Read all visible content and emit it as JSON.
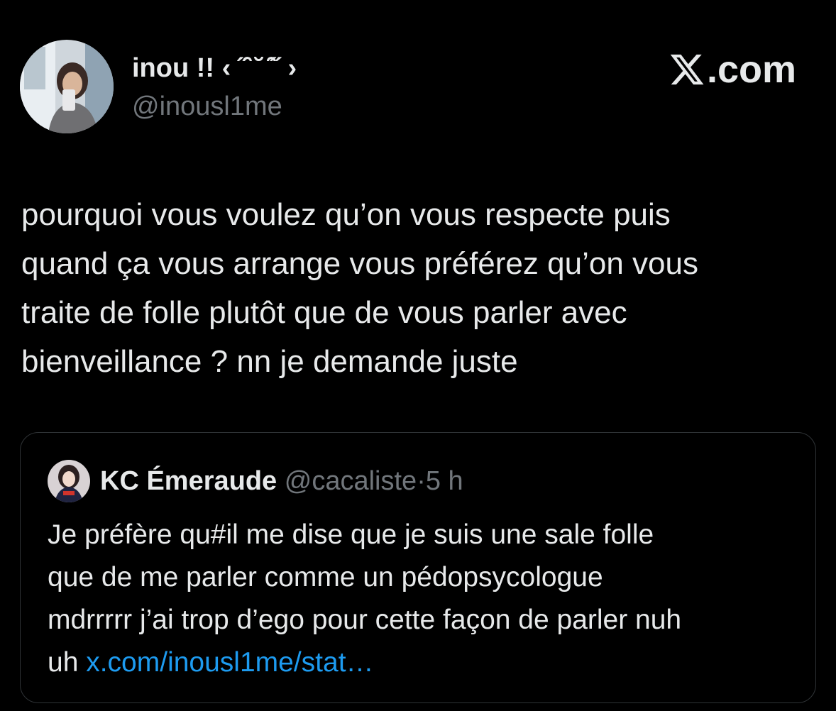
{
  "post": {
    "author_name": "inou !! ‹ ˝̑̑ ˘ ̑̑˝ ›",
    "author_handle": "@inousl1me",
    "brand": ".com",
    "text_lines": [
      "pourquoi vous voulez qu’on vous respecte puis",
      "quand ça vous arrange vous préférez qu’on vous",
      "traite de folle plutôt que de vous parler avec",
      "bienveillance ? nn je demande juste"
    ]
  },
  "quote": {
    "author_name": "KC Émeraude",
    "author_handle": "@cacaliste",
    "separator": "·",
    "time": "5 h",
    "text_lines": [
      "Je préfère qu#il me dise que je suis une sale folle",
      "que de me parler comme un pédopsycologue",
      "mdrrrrr j’ai trop d’ego pour cette façon de parler nuh"
    ],
    "last_line_prefix": "uh ",
    "link_text": "x.com/inousl1me/stat…"
  },
  "colors": {
    "background": "#000000",
    "text_primary": "#e7e9ea",
    "text_secondary": "#71767b",
    "link": "#1d9bf0",
    "border": "#2f3336"
  },
  "icons": {
    "brand_logo": "x-logo-icon"
  }
}
